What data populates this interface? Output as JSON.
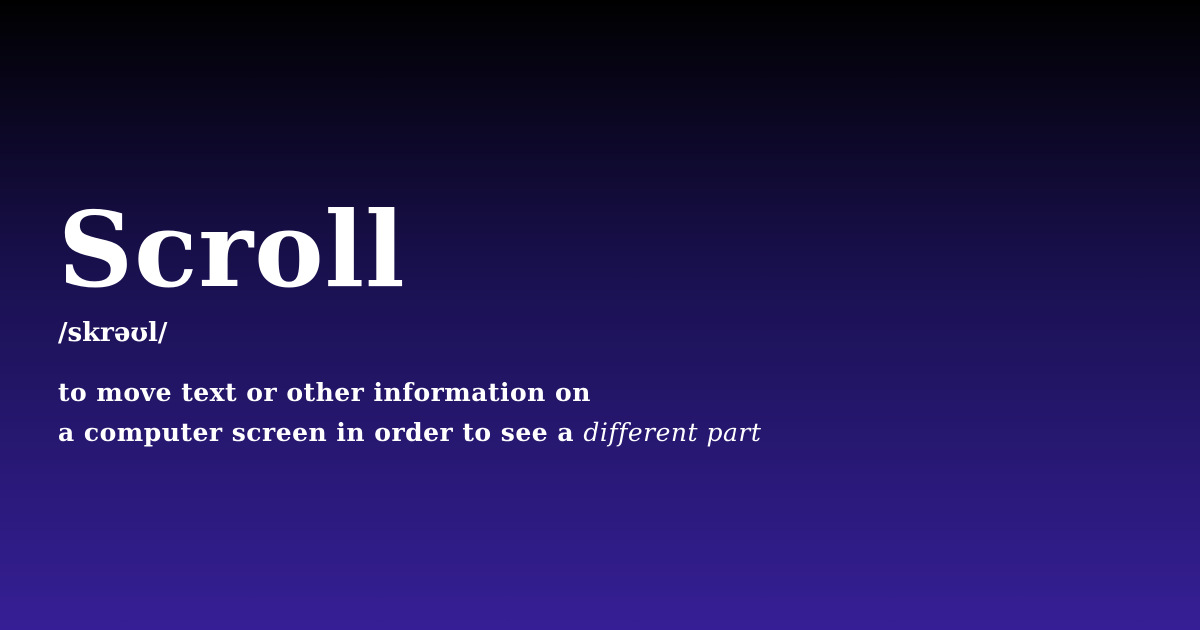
{
  "entry": {
    "word": "Scroll",
    "pronunciation": "/skrəʊl/",
    "definition": {
      "line1": "to move text or other information on",
      "line2_plain": "a computer screen in order to see a",
      "line2_emphasis": "different part"
    }
  },
  "colors": {
    "text": "#ffffff",
    "gradient_top": "#000000",
    "gradient_bottom": "#361f96"
  }
}
